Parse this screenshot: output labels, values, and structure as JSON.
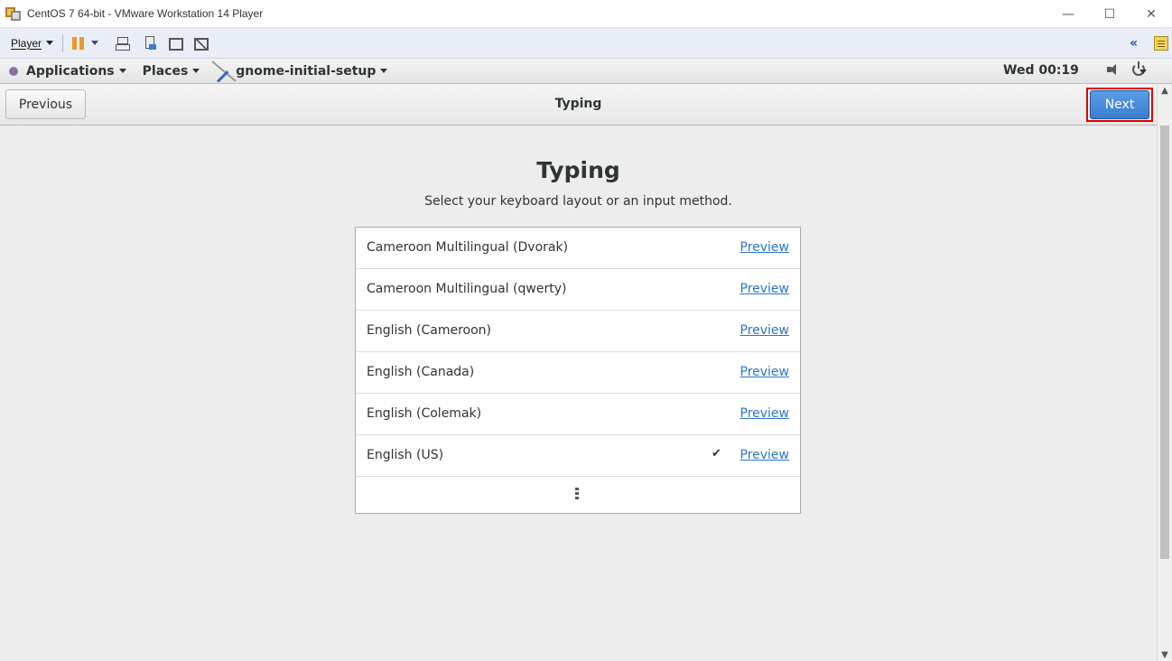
{
  "vmware": {
    "window_title": "CentOS 7 64-bit - VMware Workstation 14 Player",
    "minimize_glyph": "—",
    "maximize_glyph": "☐",
    "close_glyph": "✕",
    "player_menu_label": "Player",
    "collapse_glyph": "«"
  },
  "gnome": {
    "applications_label": "Applications",
    "places_label": "Places",
    "app_label": "gnome-initial-setup",
    "clock": "Wed 00:19"
  },
  "header": {
    "previous_label": "Previous",
    "title": "Typing",
    "next_label": "Next"
  },
  "main": {
    "heading": "Typing",
    "subtitle": "Select your keyboard layout or an input method.",
    "layouts": [
      {
        "label": "Cameroon Multilingual (Dvorak)",
        "preview": "Preview",
        "selected": false
      },
      {
        "label": "Cameroon Multilingual (qwerty)",
        "preview": "Preview",
        "selected": false
      },
      {
        "label": "English (Cameroon)",
        "preview": "Preview",
        "selected": false
      },
      {
        "label": "English (Canada)",
        "preview": "Preview",
        "selected": false
      },
      {
        "label": "English (Colemak)",
        "preview": "Preview",
        "selected": false
      },
      {
        "label": "English (US)",
        "preview": "Preview",
        "selected": true,
        "check_glyph": "✔"
      }
    ]
  },
  "colors": {
    "next_button": "#3a7dce",
    "highlight_border": "#e00000",
    "link": "#2a76c6"
  }
}
